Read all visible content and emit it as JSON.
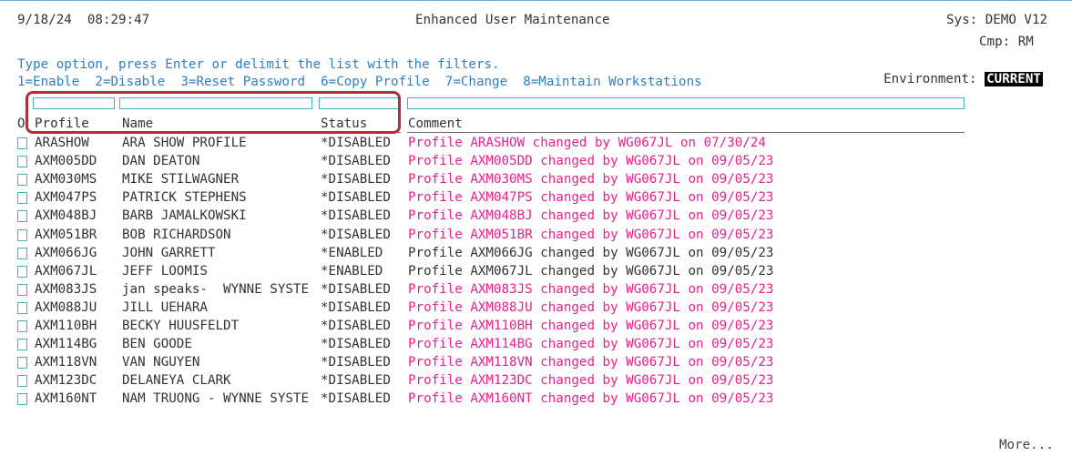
{
  "header": {
    "datetime": "9/18/24  08:29:47",
    "title": "Enhanced User Maintenance",
    "sys": "Sys: DEMO V12",
    "cmp": "Cmp: RM",
    "environment_label": "Environment:",
    "environment_value": "CURRENT"
  },
  "instructions": {
    "line1": "Type option, press Enter or delimit the list with the filters.",
    "options": "1=Enable  2=Disable  3=Reset Password  6=Copy Profile  7=Change  8=Maintain Workstations"
  },
  "columns": {
    "opt": "O",
    "profile": "Profile",
    "name": "Name",
    "status": "Status",
    "comment": "Comment"
  },
  "filters": {
    "profile": "",
    "name": "",
    "status": "",
    "comment": ""
  },
  "colors": {
    "enabled_comment": "#333333",
    "disabled_comment": "#e8218b",
    "instruction_text": "#2f7fc0",
    "highlight_border": "#b0303a"
  },
  "rows": [
    {
      "profile": "ARASHOW",
      "name": "ARA SHOW PROFILE",
      "status": "*DISABLED",
      "comment": "Profile ARASHOW changed by WG067JL on 07/30/24"
    },
    {
      "profile": "AXM005DD",
      "name": "DAN DEATON",
      "status": "*DISABLED",
      "comment": "Profile AXM005DD changed by WG067JL on 09/05/23"
    },
    {
      "profile": "AXM030MS",
      "name": "MIKE STILWAGNER",
      "status": "*DISABLED",
      "comment": "Profile AXM030MS changed by WG067JL on 09/05/23"
    },
    {
      "profile": "AXM047PS",
      "name": "PATRICK STEPHENS",
      "status": "*DISABLED",
      "comment": "Profile AXM047PS changed by WG067JL on 09/05/23"
    },
    {
      "profile": "AXM048BJ",
      "name": "BARB JAMALKOWSKI",
      "status": "*DISABLED",
      "comment": "Profile AXM048BJ changed by WG067JL on 09/05/23"
    },
    {
      "profile": "AXM051BR",
      "name": "BOB RICHARDSON",
      "status": "*DISABLED",
      "comment": "Profile AXM051BR changed by WG067JL on 09/05/23"
    },
    {
      "profile": "AXM066JG",
      "name": "JOHN GARRETT",
      "status": "*ENABLED",
      "comment": "Profile AXM066JG changed by WG067JL on 09/05/23"
    },
    {
      "profile": "AXM067JL",
      "name": "JEFF LOOMIS",
      "status": "*ENABLED",
      "comment": "Profile AXM067JL changed by WG067JL on 09/05/23"
    },
    {
      "profile": "AXM083JS",
      "name": "jan speaks-  WYNNE SYSTE",
      "status": "*DISABLED",
      "comment": "Profile AXM083JS changed by WG067JL on 09/05/23"
    },
    {
      "profile": "AXM088JU",
      "name": "JILL UEHARA",
      "status": "*DISABLED",
      "comment": "Profile AXM088JU changed by WG067JL on 09/05/23"
    },
    {
      "profile": "AXM110BH",
      "name": "BECKY HUUSFELDT",
      "status": "*DISABLED",
      "comment": "Profile AXM110BH changed by WG067JL on 09/05/23"
    },
    {
      "profile": "AXM114BG",
      "name": "BEN GOODE",
      "status": "*DISABLED",
      "comment": "Profile AXM114BG changed by WG067JL on 09/05/23"
    },
    {
      "profile": "AXM118VN",
      "name": "VAN NGUYEN",
      "status": "*DISABLED",
      "comment": "Profile AXM118VN changed by WG067JL on 09/05/23"
    },
    {
      "profile": "AXM123DC",
      "name": "DELANEYA CLARK",
      "status": "*DISABLED",
      "comment": "Profile AXM123DC changed by WG067JL on 09/05/23"
    },
    {
      "profile": "AXM160NT",
      "name": "NAM TRUONG - WYNNE SYSTE",
      "status": "*DISABLED",
      "comment": "Profile AXM160NT changed by WG067JL on 09/05/23"
    }
  ],
  "footer": {
    "more": "More..."
  }
}
